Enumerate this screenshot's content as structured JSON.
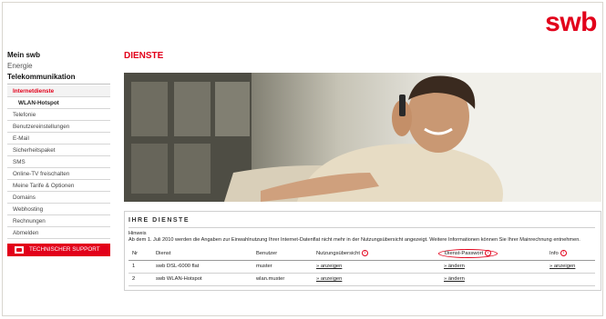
{
  "brand": {
    "logo": "swb",
    "accent": "#e2001a"
  },
  "sidebar": {
    "headers": [
      "Mein swb",
      "Energie",
      "Telekommunikation"
    ],
    "items": [
      {
        "label": "Internetdienste",
        "active": true
      },
      {
        "label": "WLAN-Hotspot",
        "sub": true
      },
      {
        "label": "Telefonie"
      },
      {
        "label": "Benutzereinstellungen"
      },
      {
        "label": "E-Mail"
      },
      {
        "label": "Sicherheitspaket"
      },
      {
        "label": "SMS"
      },
      {
        "label": "Online-TV freischalten"
      },
      {
        "label": "Meine Tarife & Optionen"
      },
      {
        "label": "Domains"
      },
      {
        "label": "Webhosting"
      },
      {
        "label": "Rechnungen"
      },
      {
        "label": "Abmelden"
      }
    ],
    "support_button": "TECHNISCHER SUPPORT"
  },
  "main": {
    "title": "DIENSTE",
    "services_title": "IHRE DIENSTE",
    "hint_label": "Hinweis",
    "hint_text": "Ab dem 1. Juli 2010 werden die Angaben zur Einwahlnutzung Ihrer Internet-Datenflat nicht mehr in der Nutzungsübersicht angezeigt. Weitere Informationen können Sie Ihrer Mainrechnung entnehmen.",
    "table": {
      "headers": [
        "Nr",
        "Dienst",
        "Benutzer",
        "Nutzungsübersicht",
        "Dienst-Passwort",
        "Info"
      ],
      "rows": [
        {
          "nr": "1",
          "dienst": "swb DSL-6000 flat",
          "benutzer": "muster",
          "nutzung": "» anzeigen",
          "passwort": "» ändern",
          "info": "» anzeigen"
        },
        {
          "nr": "2",
          "dienst": "swb WLAN-Hotspot",
          "benutzer": "wlan.muster",
          "nutzung": "» anzeigen",
          "passwort": "» ändern",
          "info": ""
        }
      ]
    }
  }
}
